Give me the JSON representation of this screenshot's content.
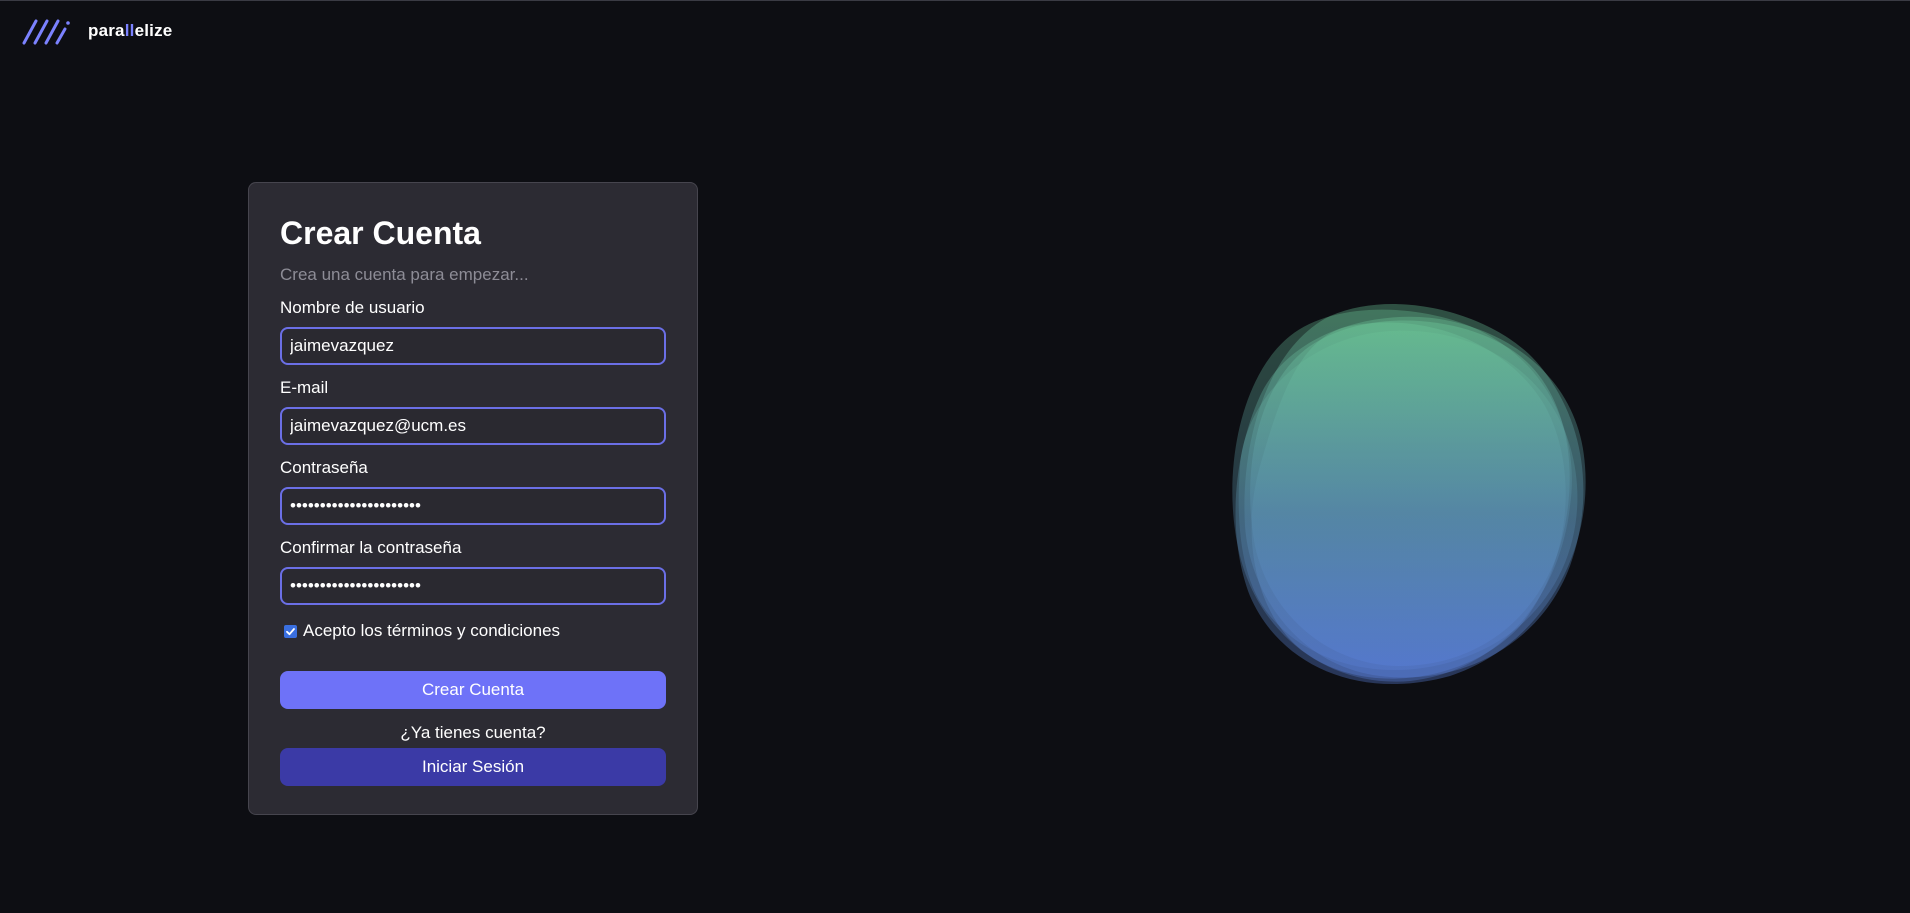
{
  "app": {
    "logo_text_start": "para",
    "logo_text_accent": "ll",
    "logo_text_end": "elize"
  },
  "form": {
    "title": "Crear Cuenta",
    "subtitle": "Crea una cuenta para empezar...",
    "username_label": "Nombre de usuario",
    "username_value": "jaimevazquez",
    "email_label": "E-mail",
    "email_value": "jaimevazquez@ucm.es",
    "password_label": "Contraseña",
    "password_value": "••••••••••••••••••••••",
    "confirm_label": "Confirmar la contraseña",
    "confirm_value": "••••••••••••••••••••••",
    "terms_label": "Acepto los términos y condiciones",
    "terms_checked": true,
    "submit_label": "Crear Cuenta",
    "have_account_text": "¿Ya tienes cuenta?",
    "login_label": "Iniciar Sesión"
  },
  "colors": {
    "background": "#0d0e13",
    "card": "#2c2b33",
    "accent": "#6e72f8",
    "accent_dark": "#3b3aa6",
    "input_border": "#6b6fe6"
  },
  "icons": {
    "logo": "parallel-slashes-icon",
    "checkbox": "checkmark-icon"
  }
}
